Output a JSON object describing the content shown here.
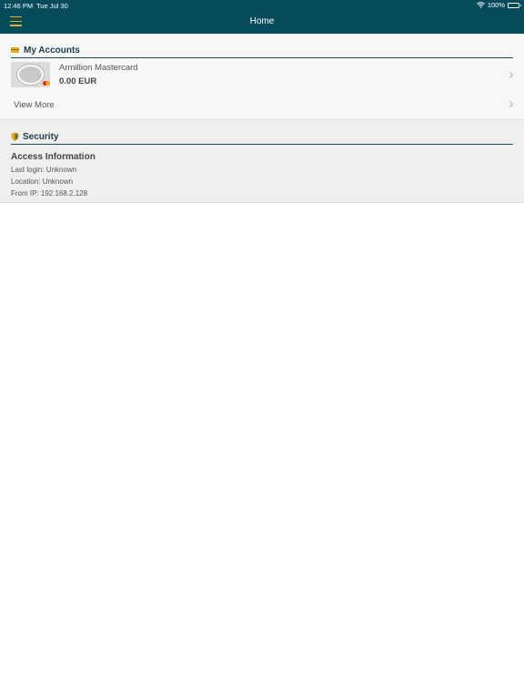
{
  "status_bar": {
    "time": "12:46 PM",
    "date": "Tue Jul 30",
    "battery": "100%",
    "icons": [
      "wifi-icon",
      "battery-icon"
    ]
  },
  "nav": {
    "title": "Home",
    "menu_icon": "hamburger-menu-icon"
  },
  "accounts": {
    "section_title": "My Accounts",
    "icon": "credit-card-icon",
    "items": [
      {
        "name": "Armillion Mastercard",
        "balance": "0.00 EUR"
      }
    ],
    "view_more": "View More"
  },
  "security": {
    "section_title": "Security",
    "icon": "shield-icon",
    "access_title": "Access Information",
    "last_login": "Last login: Unknown",
    "location": "Location: Unknown",
    "from_ip": "From IP: 192.168.2.128"
  },
  "colors": {
    "nav_bg": "#064b5c",
    "accent": "#e3ad2a",
    "section_rule": "#1c4b55"
  }
}
